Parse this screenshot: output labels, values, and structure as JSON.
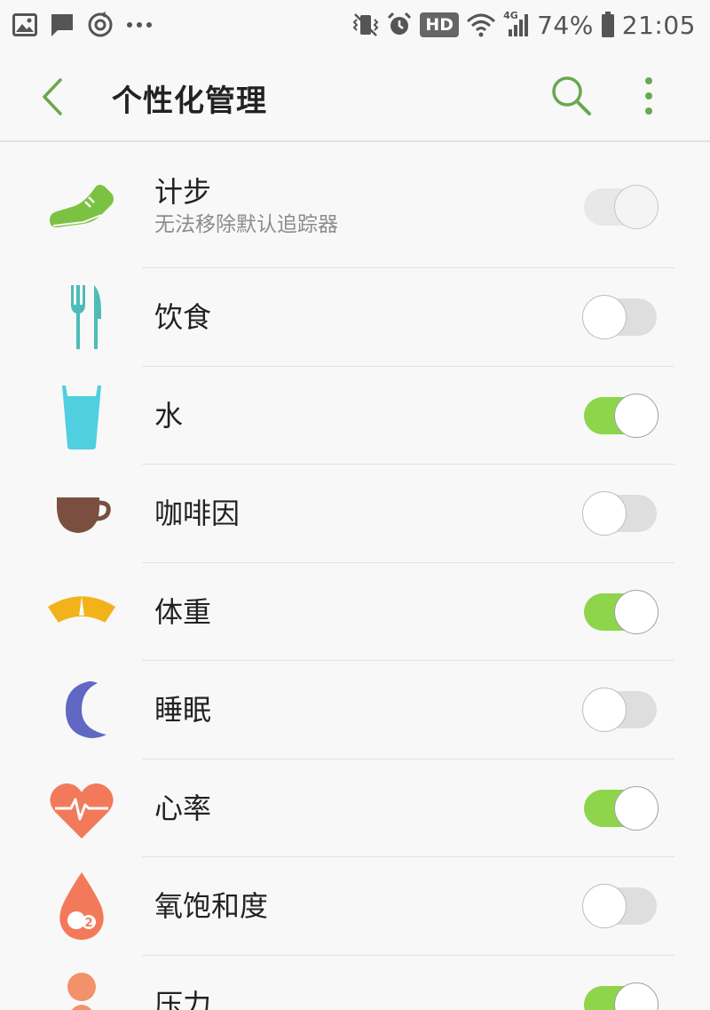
{
  "status_bar": {
    "battery": "74%",
    "time": "21:05",
    "network_badge": "HD",
    "network_type": "4G",
    "icons_left": [
      "gallery-icon",
      "message-icon",
      "sync-icon",
      "more-notifications-icon"
    ],
    "icons_right": [
      "vibrate-icon",
      "alarm-icon",
      "hd-badge",
      "wifi-icon",
      "signal-icon",
      "battery-icon"
    ]
  },
  "app_bar": {
    "title": "个性化管理",
    "accent_color": "#6aa84f"
  },
  "trackers": [
    {
      "label": "计步",
      "sublabel": "无法移除默认追踪器",
      "icon": "shoe-icon",
      "enabled": true,
      "locked": true
    },
    {
      "label": "饮食",
      "icon": "fork-knife-icon",
      "enabled": false
    },
    {
      "label": "水",
      "icon": "water-glass-icon",
      "enabled": true
    },
    {
      "label": "咖啡因",
      "icon": "coffee-cup-icon",
      "enabled": false
    },
    {
      "label": "体重",
      "icon": "scale-icon",
      "enabled": true
    },
    {
      "label": "睡眠",
      "icon": "moon-icon",
      "enabled": false
    },
    {
      "label": "心率",
      "icon": "heart-rate-icon",
      "enabled": true
    },
    {
      "label": "氧饱和度",
      "icon": "oxygen-drop-icon",
      "enabled": false
    },
    {
      "label": "压力",
      "icon": "stress-person-icon",
      "enabled": true
    }
  ],
  "colors": {
    "toggle_on": "#8ed54c",
    "toggle_off": "#dedede",
    "shoe": "#7cc242",
    "fork_knife": "#4dbcb8",
    "water": "#4fcfe0",
    "coffee": "#7a4f3f",
    "scale": "#f2b31a",
    "moon": "#6068c4",
    "heart": "#f27a5a",
    "oxygen": "#f27a5a",
    "stress": "#f2916a"
  }
}
